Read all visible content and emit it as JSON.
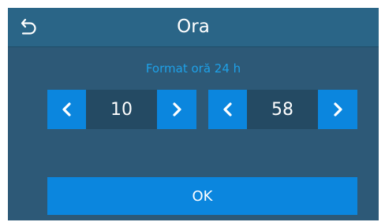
{
  "header": {
    "title": "Ora",
    "back_icon": "back-undo-icon"
  },
  "subtitle": "Format oră 24 h",
  "hour": {
    "value": "10",
    "decrement_icon": "chevron-left-icon",
    "increment_icon": "chevron-right-icon"
  },
  "minute": {
    "value": "58",
    "decrement_icon": "chevron-left-icon",
    "increment_icon": "chevron-right-icon"
  },
  "ok_label": "OK",
  "colors": {
    "background": "#2d5977",
    "header": "#2a6587",
    "accent": "#0b86de",
    "subtitle": "#1ea1e8",
    "value_box": "#244a63"
  }
}
